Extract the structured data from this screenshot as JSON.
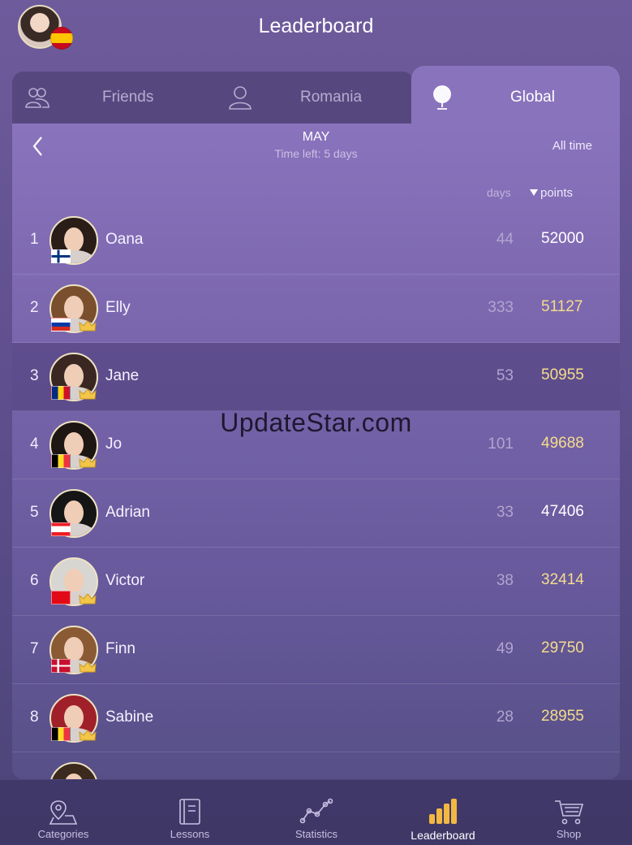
{
  "header": {
    "title": "Leaderboard"
  },
  "tabs": [
    {
      "label": "Friends",
      "icon": "friends-icon"
    },
    {
      "label": "Romania",
      "icon": "person-icon"
    },
    {
      "label": "Global",
      "icon": "globe-icon"
    }
  ],
  "period": {
    "month": "MAY",
    "time_left": "Time left: 5 days",
    "all_time": "All time"
  },
  "columns": {
    "days": "days",
    "points": "points"
  },
  "rows": [
    {
      "rank": "1",
      "name": "Oana",
      "days": "44",
      "points": "52000",
      "flag": "finland"
    },
    {
      "rank": "2",
      "name": "Elly",
      "days": "333",
      "points": "51127",
      "flag": "russia"
    },
    {
      "rank": "3",
      "name": "Jane",
      "days": "53",
      "points": "50955",
      "flag": "romania"
    },
    {
      "rank": "4",
      "name": "Jo",
      "days": "101",
      "points": "49688",
      "flag": "belgium"
    },
    {
      "rank": "5",
      "name": "Adrian",
      "days": "33",
      "points": "47406",
      "flag": "lebanon"
    },
    {
      "rank": "6",
      "name": "Victor",
      "days": "38",
      "points": "32414",
      "flag": "turkey"
    },
    {
      "rank": "7",
      "name": "Finn",
      "days": "49",
      "points": "29750",
      "flag": "denmark"
    },
    {
      "rank": "8",
      "name": "Sabine",
      "days": "28",
      "points": "28955",
      "flag": "belgium"
    }
  ],
  "watermark": "UpdateStar.com",
  "nav": [
    {
      "label": "Categories",
      "icon": "map-pin-icon"
    },
    {
      "label": "Lessons",
      "icon": "notebook-icon"
    },
    {
      "label": "Statistics",
      "icon": "line-chart-icon"
    },
    {
      "label": "Leaderboard",
      "icon": "bar-chart-icon"
    },
    {
      "label": "Shop",
      "icon": "cart-icon"
    }
  ],
  "colors": {
    "accent_gold": "#f5dc8c",
    "active_tab": "#8a73bd"
  }
}
